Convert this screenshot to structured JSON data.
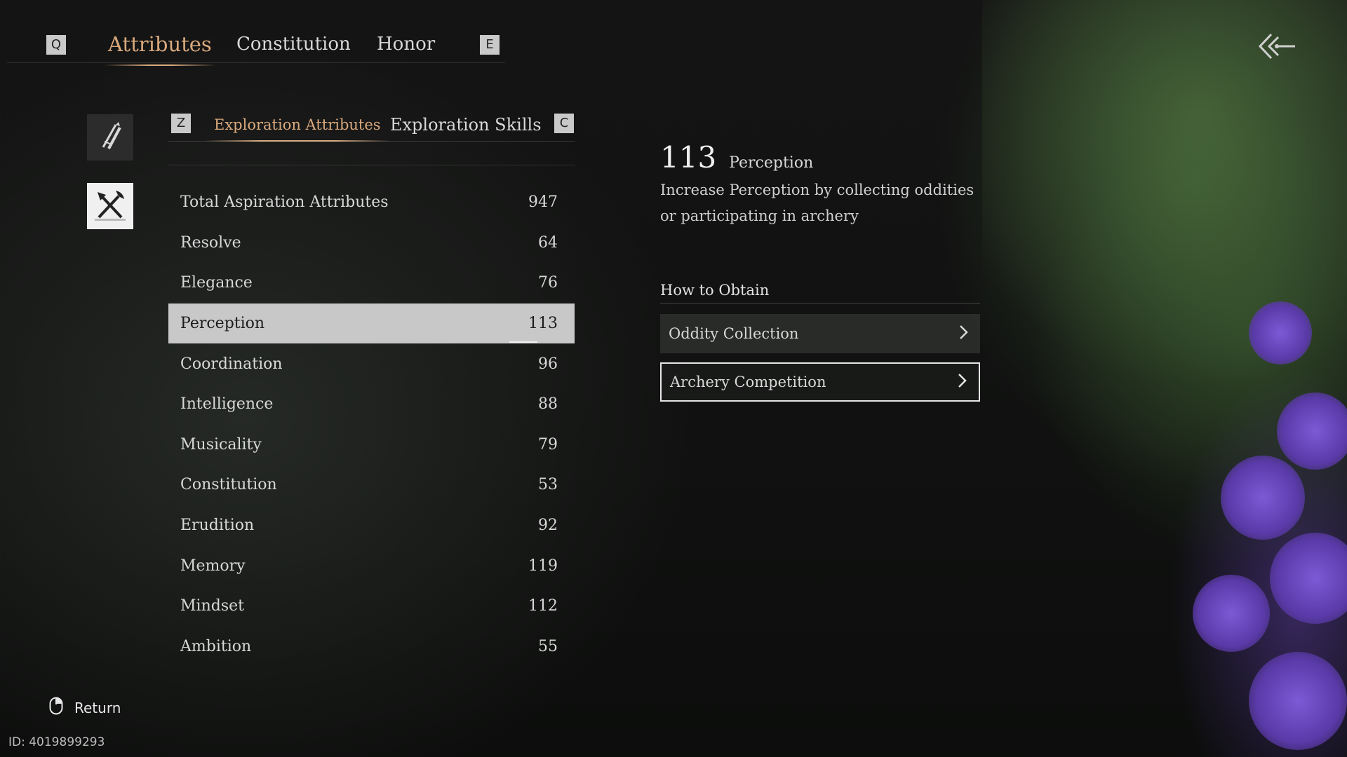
{
  "top_tabs": {
    "left_key": "Q",
    "right_key": "E",
    "items": [
      {
        "label": "Attributes",
        "active": true
      },
      {
        "label": "Constitution",
        "active": false
      },
      {
        "label": "Honor",
        "active": false
      }
    ]
  },
  "sub_tabs": {
    "left_key": "Z",
    "right_key": "C",
    "items": [
      {
        "label": "Exploration Attributes",
        "active": true
      },
      {
        "label": "Exploration Skills",
        "active": false
      }
    ]
  },
  "side_categories": [
    {
      "icon": "pen-sword-icon",
      "selected": false
    },
    {
      "icon": "shovel-pickaxe-icon",
      "selected": true
    }
  ],
  "attributes": [
    {
      "name": "Total Aspiration Attributes",
      "value": "947"
    },
    {
      "name": "Resolve",
      "value": "64"
    },
    {
      "name": "Elegance",
      "value": "76"
    },
    {
      "name": "Perception",
      "value": "113",
      "selected": true
    },
    {
      "name": "Coordination",
      "value": "96"
    },
    {
      "name": "Intelligence",
      "value": "88"
    },
    {
      "name": "Musicality",
      "value": "79"
    },
    {
      "name": "Constitution",
      "value": "53"
    },
    {
      "name": "Erudition",
      "value": "92"
    },
    {
      "name": "Memory",
      "value": "119"
    },
    {
      "name": "Mindset",
      "value": "112"
    },
    {
      "name": "Ambition",
      "value": "55"
    }
  ],
  "detail": {
    "value": "113",
    "name": "Perception",
    "description": "Increase Perception by collecting oddities or participating in archery",
    "obtain_title": "How to Obtain",
    "obtain_items": [
      {
        "label": "Oddity Collection"
      },
      {
        "label": "Archery Competition"
      }
    ]
  },
  "footer": {
    "return_label": "Return",
    "uid": "ID: 4019899293"
  },
  "colors": {
    "accent": "#d9a97d",
    "selected_row": "#c8c8c8"
  }
}
